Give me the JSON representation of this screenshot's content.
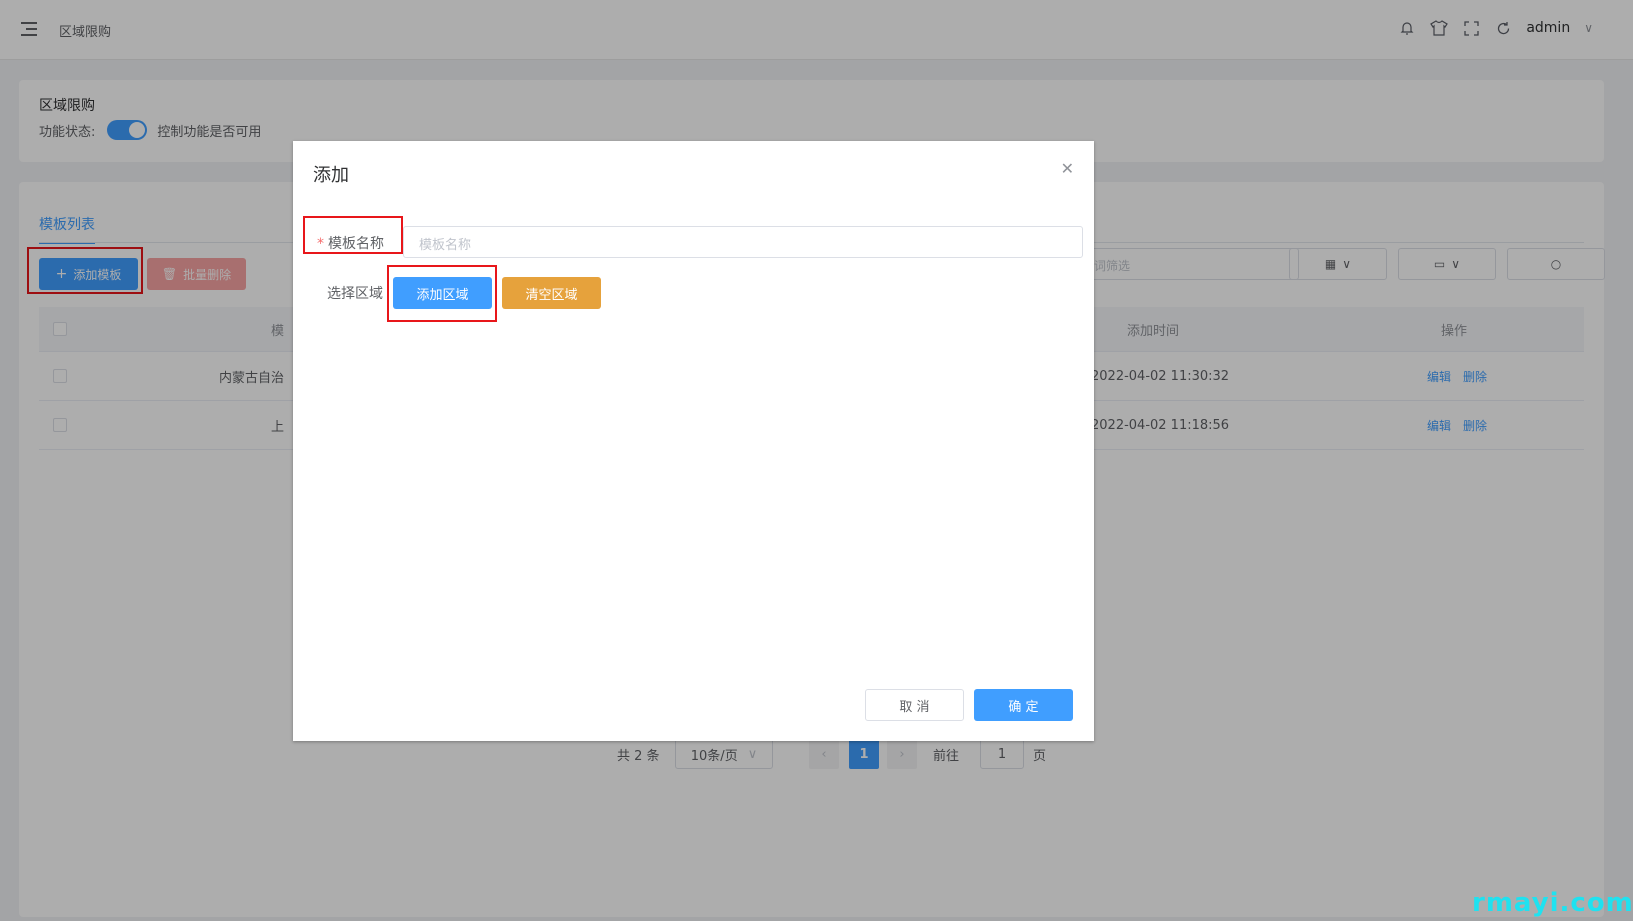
{
  "header": {
    "breadcrumb": "区域限购",
    "user": "admin"
  },
  "feature": {
    "title": "区域限购",
    "status_label": "功能状态:",
    "switch_on": true,
    "hint": "控制功能是否可用"
  },
  "list": {
    "tab": "模板列表",
    "add_button": "添加模板",
    "bulk_delete_button": "批量删除",
    "filter_placeholder": "键词筛选",
    "columns": [
      "模",
      "添加时间",
      "操作"
    ],
    "rows": [
      {
        "name": "内蒙古自治",
        "time": "2022-04-02 11:30:32",
        "edit": "编辑",
        "delete": "删除"
      },
      {
        "name": "上",
        "time": "2022-04-02 11:18:56",
        "edit": "编辑",
        "delete": "删除"
      }
    ]
  },
  "pagination": {
    "total": "共 2 条",
    "page_size": "10条/页",
    "current": "1",
    "goto_label": "前往",
    "goto_value": "1",
    "page_suffix": "页"
  },
  "dialog": {
    "title": "添加",
    "name_label": "模板名称",
    "name_placeholder": "模板名称",
    "region_label": "选择区域",
    "add_region": "添加区域",
    "clear_region": "清空区域",
    "cancel": "取 消",
    "confirm": "确 定"
  },
  "watermark": "rmayi.com",
  "colors": {
    "primary": "#409eff",
    "warning": "#e6a23c",
    "danger_light": "#f8a4a4",
    "annotation": "#e8161a"
  }
}
